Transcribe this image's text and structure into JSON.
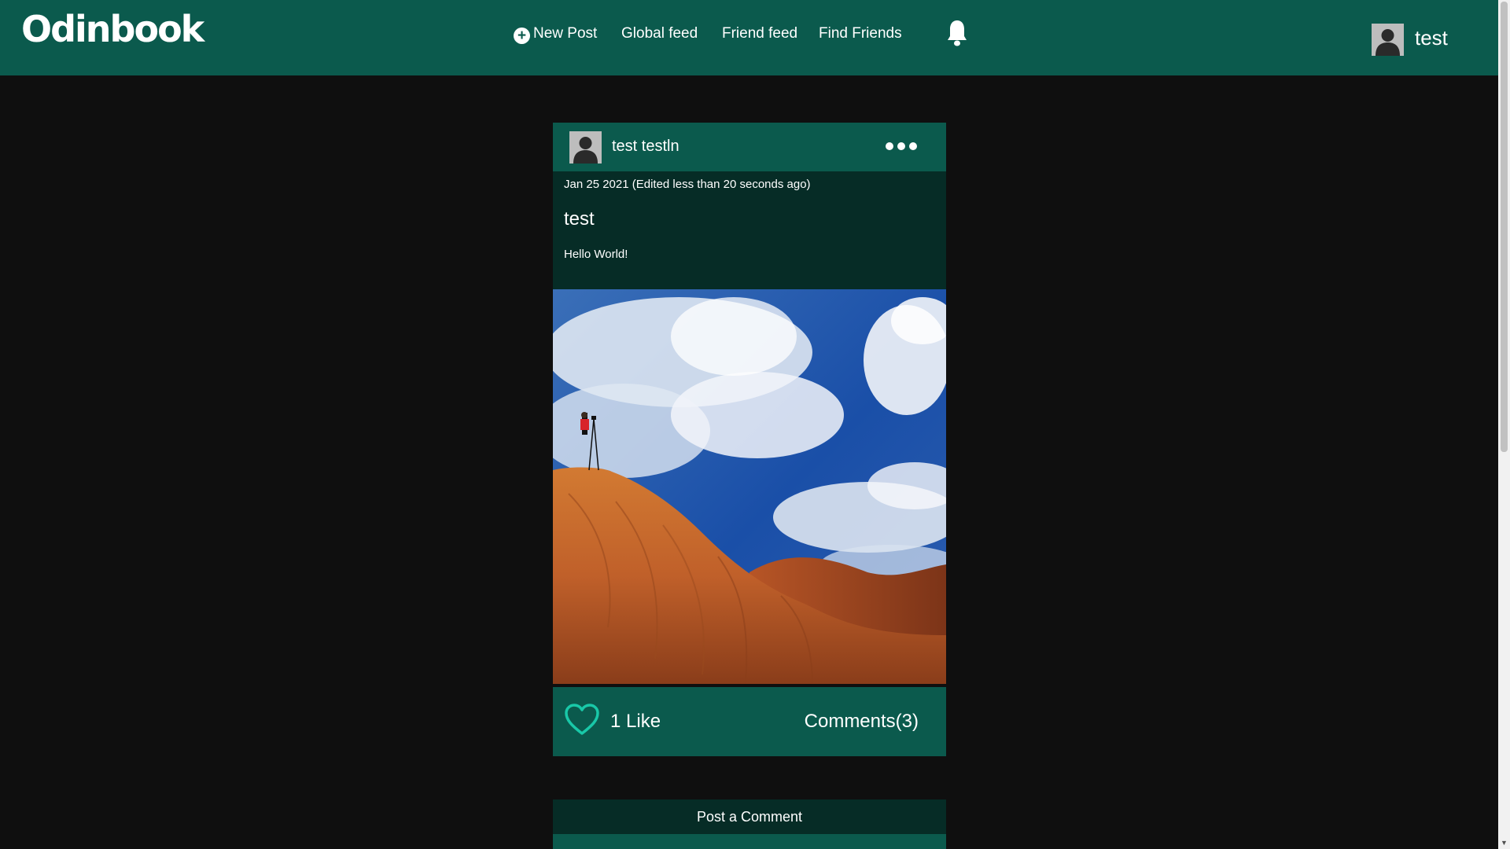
{
  "header": {
    "logo": "Odinbook",
    "nav": {
      "new_post": "New Post",
      "global_feed": "Global feed",
      "friend_feed": "Friend feed",
      "find_friends": "Find Friends"
    },
    "icons": {
      "new_post": "plus-circle-icon",
      "notifications": "bell-icon"
    },
    "user": {
      "name": "test"
    }
  },
  "post": {
    "author": "test testln",
    "date": "Jan 25 2021 (Edited less than 20 seconds ago)",
    "title": "test",
    "text": "Hello World!",
    "likes_label": "1 Like",
    "comments_label": "Comments(3)"
  },
  "comment_form": {
    "title": "Post a Comment"
  },
  "colors": {
    "header_bg": "#0b5a4d",
    "card_body_bg": "#062c26",
    "page_bg": "#0f0f0f",
    "like_heart": "#19c8a8"
  }
}
